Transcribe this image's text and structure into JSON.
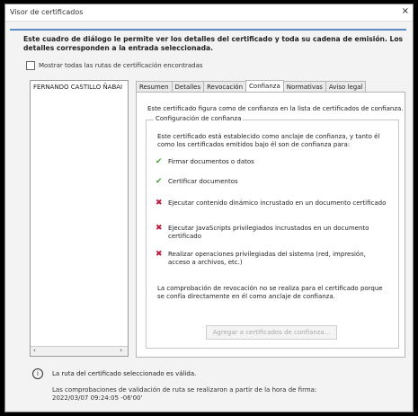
{
  "window": {
    "title": "Visor de certificados",
    "close_icon": "×"
  },
  "intro": "Este cuadro de diálogo le permite ver los detalles del certificado y toda su cadena de emisión. Los detalles corresponden a la entrada seleccionada.",
  "show_all_paths": {
    "label": "Mostrar todas las rutas de certificación encontradas",
    "checked": false
  },
  "tree": {
    "items": [
      "FERNANDO CASTILLO ÑABAI"
    ],
    "scroll_left": "‹",
    "scroll_right": "›"
  },
  "tabs": [
    {
      "label": "Resumen",
      "active": false
    },
    {
      "label": "Detalles",
      "active": false
    },
    {
      "label": "Revocación",
      "active": false
    },
    {
      "label": "Confianza",
      "active": true
    },
    {
      "label": "Normativas",
      "active": false
    },
    {
      "label": "Aviso legal",
      "active": false
    }
  ],
  "trust": {
    "intro": "Este certificado figura como de confianza en la lista de certificados de confianza.",
    "group_title": "Configuración de confianza",
    "description": "Este certificado está establecido como anclaje de confianza, y tanto él como los certificados emitidos bajo él son de confianza para:",
    "permissions": [
      {
        "label": "Firmar documentos o datos",
        "allowed": true,
        "icon": "check-icon"
      },
      {
        "label": "Certificar documentos",
        "allowed": true,
        "icon": "check-icon"
      },
      {
        "label": "Ejecutar contenido dinámico incrustado en un documento certificado",
        "allowed": false,
        "icon": "cross-icon"
      },
      {
        "label": "Ejecutar JavaScripts privilegiados incrustados en un documento certificado",
        "allowed": false,
        "icon": "cross-icon"
      },
      {
        "label": "Realizar operaciones privilegiadas del sistema (red, impresión, acceso a archivos, etc.)",
        "allowed": false,
        "icon": "cross-icon"
      }
    ],
    "revocation_note": "La comprobación de revocación no se realiza para el certificado porque se confía directamente en él como anclaje de confianza.",
    "add_button": "Agregar a certificados de confianza..."
  },
  "status": {
    "path_valid": "La ruta del certificado seleccionado es válida.",
    "validation_note": "Las comprobaciones de validación de ruta se realizaron a partir de la hora de firma:",
    "validation_time": "2022/03/07 09:24:05 -06'00'"
  },
  "colors": {
    "accent_rule": "#5b8cc7",
    "check": "#4aa03a",
    "cross": "#c2183c"
  }
}
